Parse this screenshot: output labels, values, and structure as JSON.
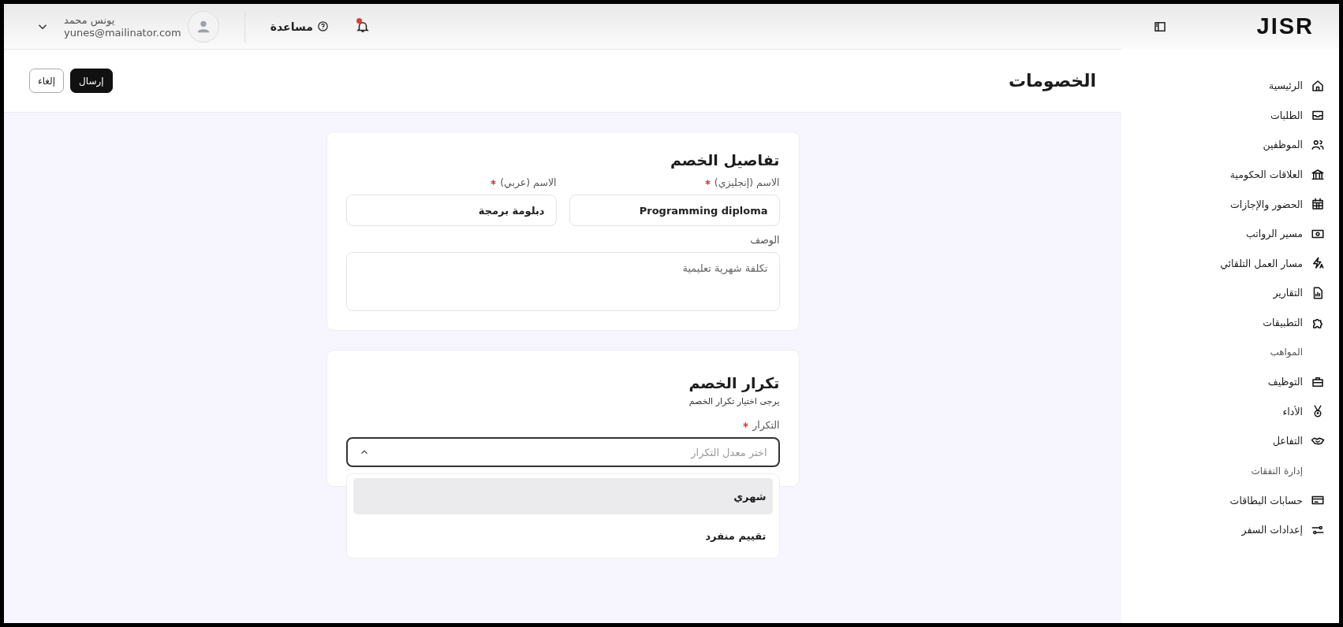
{
  "sidebar": {
    "logo": "JISR",
    "items": [
      {
        "kind": "item",
        "label": "الرئيسية"
      },
      {
        "kind": "item",
        "label": "الطلبات"
      },
      {
        "kind": "item",
        "label": "الموظفين"
      },
      {
        "kind": "item",
        "label": "العلاقات الحكومية"
      },
      {
        "kind": "item",
        "label": "الحضور والإجازات"
      },
      {
        "kind": "item",
        "label": "مسير الرواتب"
      },
      {
        "kind": "item",
        "label": "مسار العمل التلقائي"
      },
      {
        "kind": "item",
        "label": "التقارير"
      },
      {
        "kind": "item",
        "label": "التطبيقات"
      },
      {
        "kind": "section",
        "label": "المواهب"
      },
      {
        "kind": "item",
        "label": "التوظيف"
      },
      {
        "kind": "item",
        "label": "الأداء"
      },
      {
        "kind": "item",
        "label": "التفاعل"
      },
      {
        "kind": "section",
        "label": "إدارة النفقات"
      },
      {
        "kind": "item",
        "label": "حسابات البطاقات"
      },
      {
        "kind": "item",
        "label": "إعدادات السفر"
      }
    ]
  },
  "topbar": {
    "notification_dot": true,
    "help": "مساعدة",
    "user_name": "يونس محمد",
    "user_email": "yunes@mailinator.com"
  },
  "page": {
    "title": "الخصومات",
    "buttons": [
      {
        "kind": "primary",
        "label": "إرسال"
      },
      {
        "kind": "secondary",
        "label": "إلغاء"
      }
    ]
  },
  "details_card": {
    "title": "تفاصيل الخصم",
    "fields": [
      {
        "label": "الاسم (إنجليزي)",
        "required": true,
        "value": "Programming diploma"
      },
      {
        "label": "الاسم (عربي)",
        "required": true,
        "value": "دبلومة برمجة"
      }
    ],
    "description": {
      "label": "الوصف",
      "placeholder": "تكلفة شهرية تعليمية"
    }
  },
  "frequency_card": {
    "title": "تكرار الخصم",
    "subtitle": "يرجى اختيار تكرار الخصم",
    "select": {
      "label": "التكرار",
      "required": true,
      "placeholder": "اختر معدل التكرار",
      "expanded": true,
      "options": [
        {
          "label": "شهري",
          "selected": true
        },
        {
          "label": "تقييم منفرد",
          "selected": false
        }
      ]
    }
  }
}
